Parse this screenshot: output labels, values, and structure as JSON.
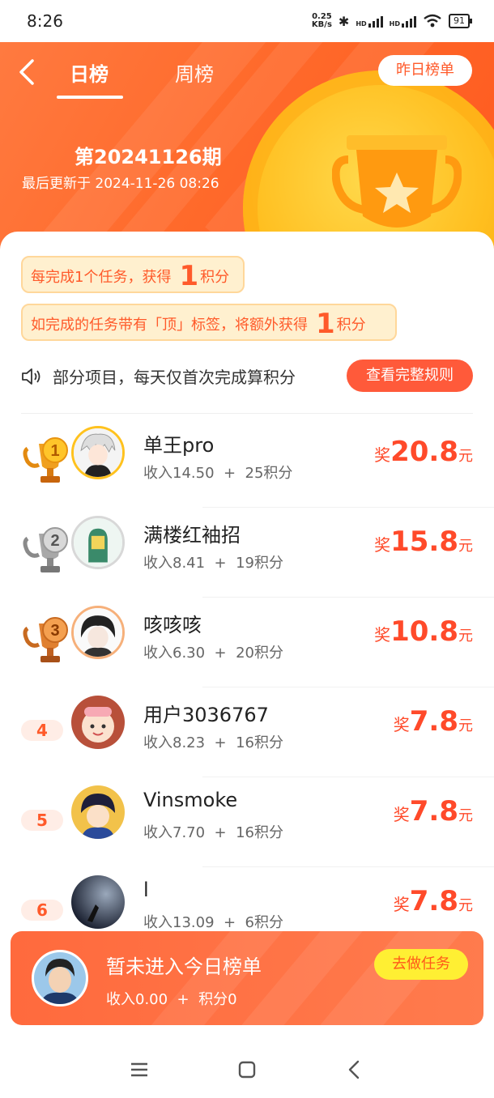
{
  "status_bar": {
    "time": "8:26",
    "speed_top": "0.25",
    "speed_bottom": "KB/s",
    "hd1": "HD",
    "hd2": "HD",
    "battery": "91"
  },
  "header": {
    "tabs": [
      "日榜",
      "周榜"
    ],
    "yesterday_button": "昨日榜单",
    "period": "第20241126期",
    "updated": "最后更新于 2024-11-26 08:26",
    "accent": "#ff6a2b"
  },
  "tips": {
    "tip1": {
      "pre": "每完成1个任务，获得",
      "num": "1",
      "post": "积分"
    },
    "tip2": {
      "pre": "如完成的任务带有「顶」标签，将额外获得",
      "num": "1",
      "post": "积分"
    }
  },
  "notice": {
    "text": "部分项目，每天仅首次完成算积分",
    "button": "查看完整规则"
  },
  "ranking": [
    {
      "rank": "1",
      "name": "单王pro",
      "income": "收入14.50",
      "plus": "+",
      "points": "25积分",
      "prefix": "奖",
      "amount": "20.8",
      "unit": "元"
    },
    {
      "rank": "2",
      "name": "满楼红袖招",
      "income": "收入8.41",
      "plus": "+",
      "points": "19积分",
      "prefix": "奖",
      "amount": "15.8",
      "unit": "元"
    },
    {
      "rank": "3",
      "name": "咳咳咳",
      "income": "收入6.30",
      "plus": "+",
      "points": "20积分",
      "prefix": "奖",
      "amount": "10.8",
      "unit": "元"
    },
    {
      "rank": "4",
      "name": "用户3036767",
      "income": "收入8.23",
      "plus": "+",
      "points": "16积分",
      "prefix": "奖",
      "amount": "7.8",
      "unit": "元"
    },
    {
      "rank": "5",
      "name": "Vinsmoke",
      "income": "收入7.70",
      "plus": "+",
      "points": "16积分",
      "prefix": "奖",
      "amount": "7.8",
      "unit": "元"
    },
    {
      "rank": "6",
      "name": "l",
      "income": "收入13.09",
      "plus": "+",
      "points": "6积分",
      "prefix": "奖",
      "amount": "7.8",
      "unit": "元"
    }
  ],
  "my_status": {
    "title": "暂未进入今日榜单",
    "income": "收入0.00",
    "plus": "+",
    "points": "积分0",
    "button": "去做任务"
  }
}
